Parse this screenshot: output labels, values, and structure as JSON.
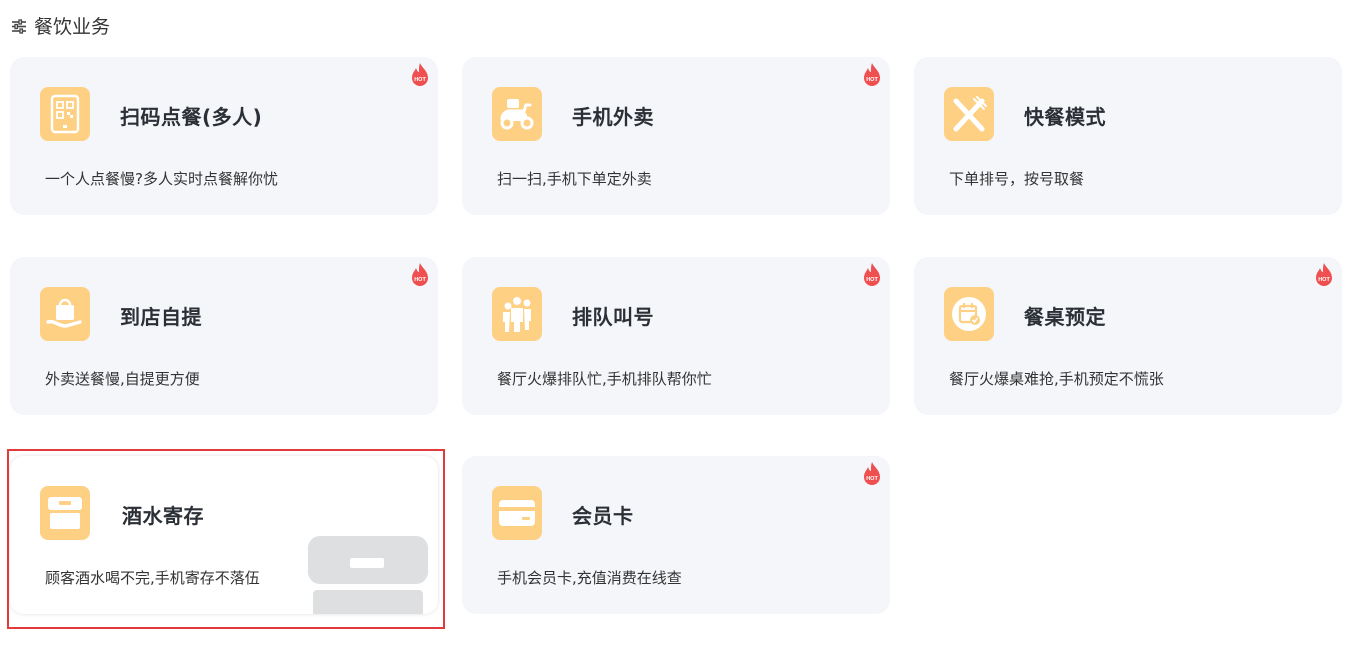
{
  "section": {
    "title": "餐饮业务",
    "icon": "sliders-icon"
  },
  "colors": {
    "card_bg": "#f5f6fa",
    "icon_bg": "#fdd084",
    "hot_badge": "#ef4f4f",
    "highlight": "#e23b3b"
  },
  "hot_label": "HOT",
  "cards": [
    {
      "title": "扫码点餐(多人)",
      "desc": "一个人点餐慢?多人实时点餐解你忧",
      "icon": "qr-code-icon",
      "hot": true
    },
    {
      "title": "手机外卖",
      "desc": "扫一扫,手机下单定外卖",
      "icon": "scooter-icon",
      "hot": true
    },
    {
      "title": "快餐模式",
      "desc": "下单排号，按号取餐",
      "icon": "fork-knife-icon",
      "hot": false
    },
    {
      "title": "到店自提",
      "desc": "外卖送餐慢,自提更方便",
      "icon": "pickup-bag-icon",
      "hot": true
    },
    {
      "title": "排队叫号",
      "desc": "餐厅火爆排队忙,手机排队帮你忙",
      "icon": "queue-people-icon",
      "hot": true
    },
    {
      "title": "餐桌预定",
      "desc": "餐厅火爆桌难抢,手机预定不慌张",
      "icon": "calendar-check-icon",
      "hot": true
    },
    {
      "title": "酒水寄存",
      "desc": "顾客酒水喝不完,手机寄存不落伍",
      "icon": "storage-box-icon",
      "hot": false,
      "selected": true
    },
    {
      "title": "会员卡",
      "desc": "手机会员卡,充值消费在线查",
      "icon": "member-card-icon",
      "hot": true
    }
  ]
}
